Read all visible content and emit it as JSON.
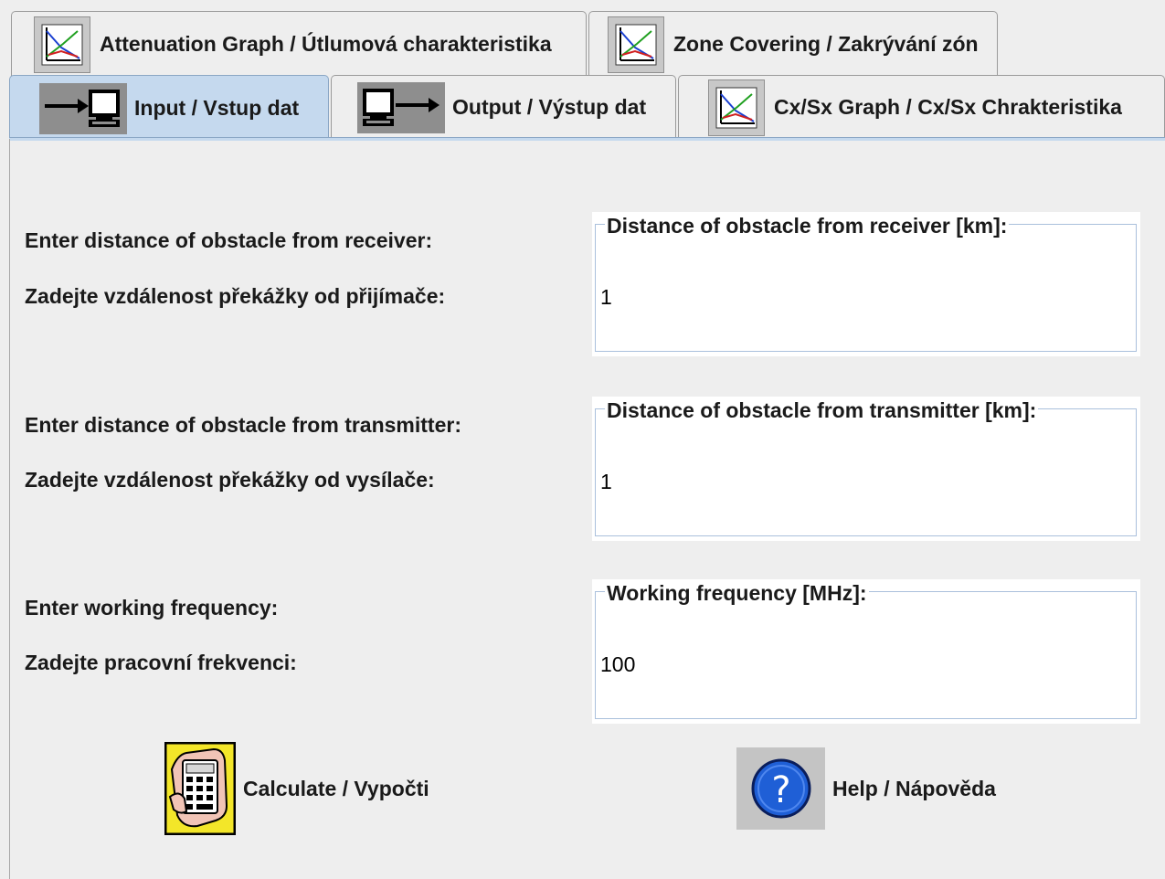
{
  "tabs_row_top": [
    {
      "label": "Attenuation Graph /  Útlumová charakteristika",
      "icon": "graph-icon"
    },
    {
      "label": "Zone Covering / Zakrývání zón",
      "icon": "graph-icon"
    }
  ],
  "tabs_row_bottom": [
    {
      "label": "Input / Vstup dat",
      "icon": "input-icon",
      "selected": true
    },
    {
      "label": "Output / Výstup dat",
      "icon": "output-icon",
      "selected": false
    },
    {
      "label": "Cx/Sx Graph / Cx/Sx Chrakteristika",
      "icon": "graph-icon",
      "selected": false
    }
  ],
  "receiver": {
    "prompt_en": "Enter distance of obstacle from receiver:",
    "prompt_cz": "Zadejte vzdálenost překážky od přijímače:",
    "field_title": "Distance of obstacle from receiver [km]:",
    "value": "1"
  },
  "transmitter": {
    "prompt_en": "Enter distance of obstacle from transmitter:",
    "prompt_cz": "Zadejte vzdálenost překážky od vysílače:",
    "field_title": "Distance of obstacle from transmitter [km]:",
    "value": "1"
  },
  "frequency": {
    "prompt_en": "Enter working frequency:",
    "prompt_cz": "Zadejte pracovní frekvenci:",
    "field_title": "Working frequency [MHz]:",
    "value": "100"
  },
  "buttons": {
    "calculate": {
      "label": "Calculate / Vypočti",
      "icon": "calculator-icon"
    },
    "help": {
      "label": "Help / Nápověda",
      "icon": "help-icon"
    }
  },
  "colors": {
    "selected_tab": "#c5d9ee",
    "background": "#eeeeee",
    "help_icon_blue": "#1f5fd6"
  }
}
